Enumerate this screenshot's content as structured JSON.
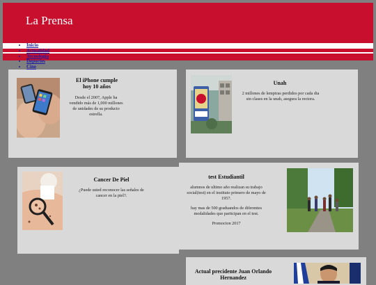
{
  "site": {
    "title": "La Prensa"
  },
  "colors": {
    "brand_red": "#c8102e",
    "page_bg": "#808080",
    "card_bg": "#d9d9d9",
    "link": "#1a1aa6"
  },
  "nav": {
    "items": [
      {
        "label": "Inicio"
      },
      {
        "label": "Actualidad"
      },
      {
        "label": "Tecnologia"
      },
      {
        "label": "Deportes"
      },
      {
        "label": "Cine"
      }
    ]
  },
  "articles": [
    {
      "title": "El iPhone cumple hoy 10 años",
      "paragraphs": [
        "Desde el 2007, Apple ha vendido más de 1,000 millones de unidades de su producto estrella."
      ],
      "image": "iphone-hands-photo"
    },
    {
      "title": "Unah",
      "paragraphs": [
        "2 millones de lempiras perdidos por cada dia sin clases en la unah, asegura la rectora."
      ],
      "image": "unah-campus-photo"
    },
    {
      "title": "Cancer De Piel",
      "paragraphs": [
        "¿Puede usted reconocer las señales de cancer en la piel?."
      ],
      "image": "skin-exam-photo"
    },
    {
      "title": "test Estudiantil",
      "paragraphs": [
        "alumnos de ultimo año realizan su trabajo social(test) en el instituto primero de mayo de 1957.",
        "hay mas de 500 graduandos de diferentes modalidades que participan en el test.",
        "Promocion 2017"
      ],
      "image": "students-park-photo"
    },
    {
      "title": "Actual precidente Juan Orlando Hernandez",
      "paragraphs": [],
      "image": "president-photo"
    }
  ]
}
